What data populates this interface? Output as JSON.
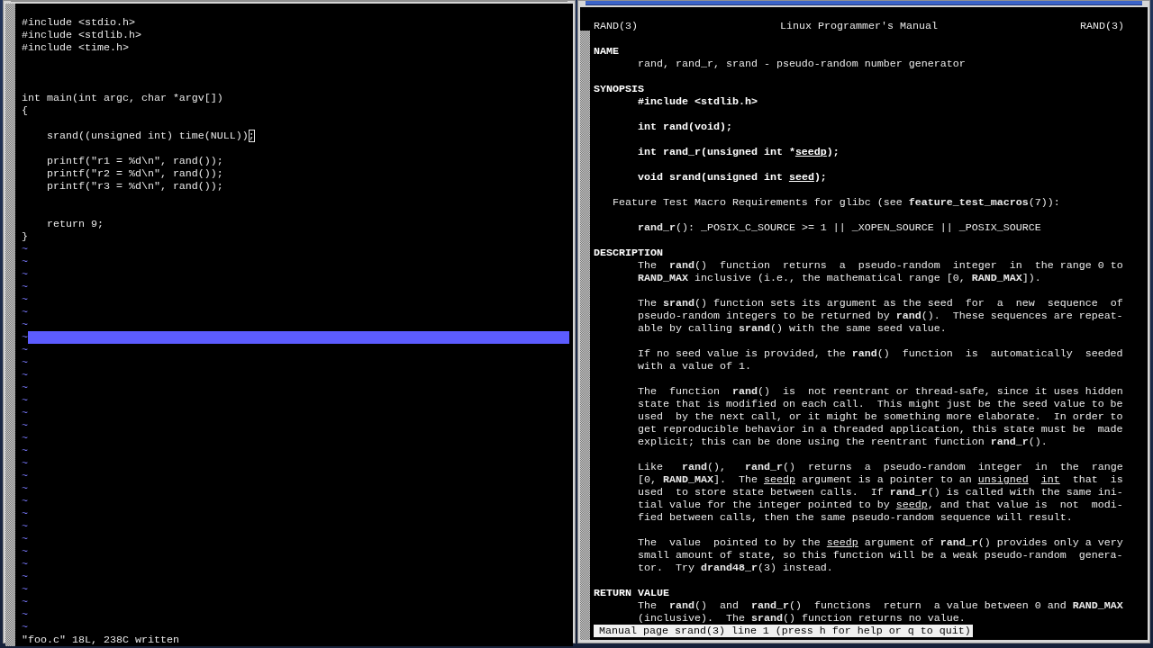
{
  "editor": {
    "lines": [
      {
        "text": "#include <stdio.h>"
      },
      {
        "text": "#include <stdlib.h>"
      },
      {
        "text": "#include <time.h>"
      },
      {
        "text": "\n\n\nint main(int argc, char *argv[])"
      },
      {
        "text": "{"
      },
      {
        "text": "\n    srand((unsigned int) time(NULL))",
        "cursor_char": ";"
      },
      {
        "text": "\n    printf(\"r1 = %d\\n\", rand());"
      },
      {
        "text": "    printf(\"r2 = %d\\n\", rand());"
      },
      {
        "text": "    printf(\"r3 = %d\\n\", rand());"
      },
      {
        "text": "\n\n    return 9;"
      },
      {
        "text": "}"
      }
    ],
    "filler_lines": [
      {
        "text": "~",
        "highlighted": false
      },
      {
        "text": "~",
        "highlighted": false
      },
      {
        "text": "~",
        "highlighted": false
      },
      {
        "text": "~",
        "highlighted": false
      },
      {
        "text": "~",
        "highlighted": false
      },
      {
        "text": "~",
        "highlighted": false
      },
      {
        "text": "~",
        "highlighted": false
      },
      {
        "text": "~",
        "highlighted": true
      },
      {
        "text": "~",
        "highlighted": false
      },
      {
        "text": "~",
        "highlighted": false
      },
      {
        "text": "~",
        "highlighted": false
      },
      {
        "text": "~",
        "highlighted": false
      },
      {
        "text": "~",
        "highlighted": false
      },
      {
        "text": "~",
        "highlighted": false
      },
      {
        "text": "~",
        "highlighted": false
      },
      {
        "text": "~",
        "highlighted": false
      },
      {
        "text": "~",
        "highlighted": false
      },
      {
        "text": "~",
        "highlighted": false
      },
      {
        "text": "~",
        "highlighted": false
      },
      {
        "text": "~",
        "highlighted": false
      },
      {
        "text": "~",
        "highlighted": false
      },
      {
        "text": "~",
        "highlighted": false
      },
      {
        "text": "~",
        "highlighted": false
      },
      {
        "text": "~",
        "highlighted": false
      },
      {
        "text": "~",
        "highlighted": false
      },
      {
        "text": "~",
        "highlighted": false
      },
      {
        "text": "~",
        "highlighted": false
      },
      {
        "text": "~",
        "highlighted": false
      },
      {
        "text": "~",
        "highlighted": false
      },
      {
        "text": "~",
        "highlighted": false
      },
      {
        "text": "~",
        "highlighted": false
      }
    ],
    "status": "\"foo.c\" 18L, 238C written"
  },
  "man_page": {
    "header": {
      "left": "RAND(3)",
      "center": "Linux Programmer's Manual",
      "right": "RAND(3)"
    },
    "sections": [
      {
        "heading": "NAME",
        "paragraphs": [
          {
            "kind": "body",
            "lines": [
              "rand, rand_r, srand - pseudo-random number generator"
            ]
          }
        ]
      },
      {
        "heading": "SYNOPSIS",
        "paragraphs": [
          {
            "kind": "synopsis",
            "lines": [
              "#include <stdlib.h>"
            ]
          },
          {
            "kind": "synopsis",
            "lines": [
              "int rand(void);"
            ]
          },
          {
            "kind": "synopsis",
            "lines": [
              [
                {
                  "text": "int rand_r(unsigned int *",
                  "underline": false
                },
                {
                  "text": "seedp",
                  "underline": true
                },
                {
                  "text": ");",
                  "underline": false
                }
              ]
            ]
          },
          {
            "kind": "synopsis",
            "lines": [
              "void srand(unsigned int *seed*);"
            ]
          },
          {
            "kind": "note",
            "lines": [
              "Feature Test Macro Requirements for glibc (see **feature_test_macros**(7)):"
            ]
          },
          {
            "kind": "body",
            "lines": [
              "**rand_r**(): _POSIX_C_SOURCE >= 1 || _XOPEN_SOURCE || _POSIX_SOURCE"
            ]
          }
        ]
      },
      {
        "heading": "DESCRIPTION",
        "paragraphs": [
          {
            "kind": "body",
            "lines": [
              "The  **rand**()  function  returns  a  pseudo-random  integer  in  the range 0 to",
              "**RAND_MAX** inclusive (i.e., the mathematical range [0, **RAND_MAX**])."
            ]
          },
          {
            "kind": "body",
            "lines": [
              "The **srand**() function sets its argument as the seed  for  a  new  sequence  of",
              "pseudo-random integers to be returned by **rand**().  These sequences are repeat-",
              "able by calling **srand**() with the same seed value."
            ]
          },
          {
            "kind": "body",
            "lines": [
              "If no seed value is provided, the **rand**()  function  is  automatically  seeded",
              "with a value of 1."
            ]
          },
          {
            "kind": "body",
            "lines": [
              "The  function  **rand**()  is  not reentrant or thread-safe, since it uses hidden",
              "state that is modified on each call.  This might just be the seed value to be",
              "used  by the next call, or it might be something more elaborate.  In order to",
              "get reproducible behavior in a threaded application, this state must be  made",
              "explicit; this can be done using the reentrant function **rand_r**()."
            ]
          },
          {
            "kind": "body",
            "lines": [
              "Like   **rand**(),   **rand_r**()  returns  a  pseudo-random  integer  in  the  range",
              "[0, **RAND_MAX**].  The *seedp* argument is a pointer to an *unsigned*  *int*  that  is",
              "used  to store state between calls.  If **rand_r**() is called with the same ini-",
              "tial value for the integer pointed to by *seedp*, and that value is  not  modi-",
              "fied between calls, then the same pseudo-random sequence will result."
            ]
          },
          {
            "kind": "body",
            "lines": [
              "The  value  pointed to by the *seedp* argument of **rand_r**() provides only a very",
              "small amount of state, so this function will be a weak pseudo-random  genera-",
              "tor.  Try **drand48_r**(3) instead."
            ]
          }
        ]
      },
      {
        "heading": "RETURN VALUE",
        "paragraphs": [
          {
            "kind": "body",
            "lines": [
              "The  **rand**()  and  **rand_r**()  functions  return  a value between 0 and **RAND_MAX**",
              "(inclusive).  The **srand**() function returns no value."
            ]
          }
        ]
      }
    ],
    "status": "Manual page srand(3) line 1 (press h for help or q to quit)"
  }
}
